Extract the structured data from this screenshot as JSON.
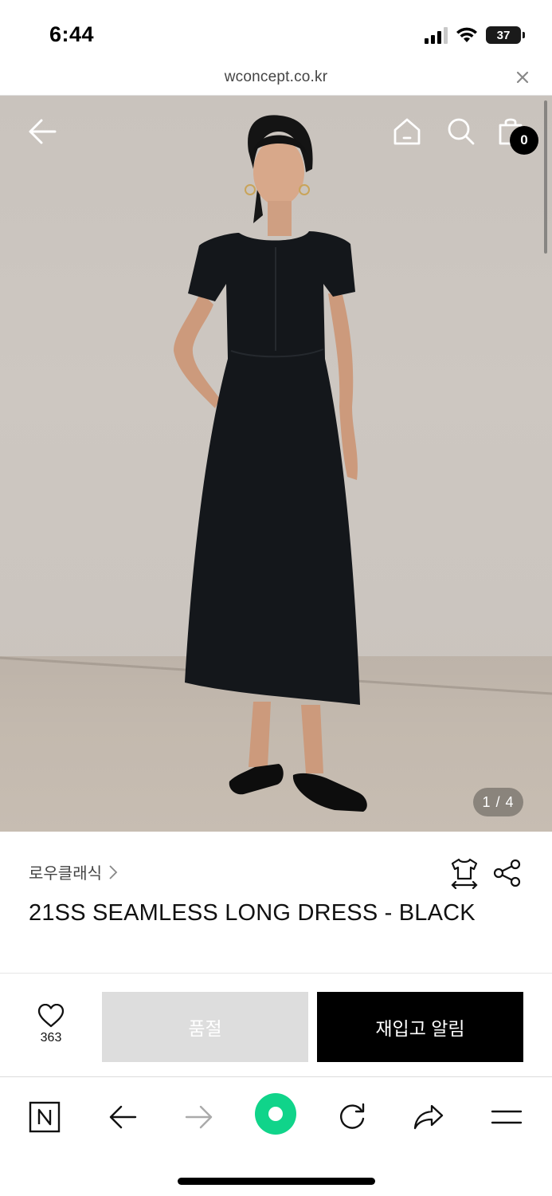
{
  "status_bar": {
    "time": "6:44",
    "battery": "37"
  },
  "browser": {
    "url": "wconcept.co.kr"
  },
  "hero": {
    "page_indicator": "1 / 4",
    "cart_count": "0"
  },
  "product": {
    "brand": "로우클래식",
    "title": "21SS SEAMLESS LONG DRESS - BLACK"
  },
  "actions": {
    "like_count": "363",
    "soldout_label": "품절",
    "restock_label": "재입고 알림"
  },
  "icons": {
    "status": [
      "signal-icon",
      "wifi-icon",
      "battery-icon"
    ],
    "header": [
      "back-arrow-icon",
      "home-icon",
      "search-icon",
      "cart-icon"
    ],
    "info": [
      "chevron-right-icon",
      "size-guide-icon",
      "share-icon"
    ],
    "toolbar": [
      "naver-icon",
      "back-icon",
      "forward-icon",
      "green-dot-icon",
      "reload-icon",
      "share-arrow-icon",
      "menu-icon"
    ]
  },
  "colors": {
    "accent_green": "#10d48a",
    "restock_bg": "#000000",
    "soldout_bg": "#dddddd"
  }
}
